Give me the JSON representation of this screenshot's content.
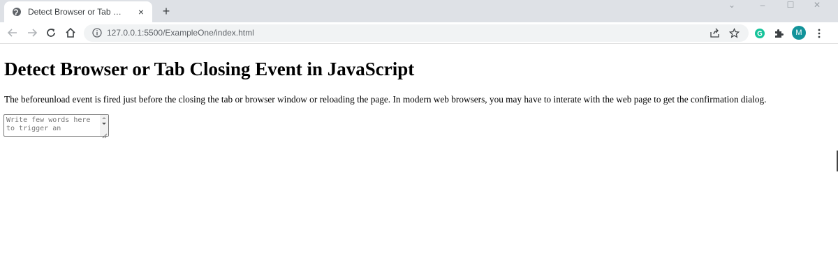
{
  "browser": {
    "tab": {
      "title": "Detect Browser or Tab Closing Event in JavaScript",
      "close_glyph": "×",
      "favicon": "globe-icon"
    },
    "new_tab_glyph": "+",
    "window_controls": [
      "⌄",
      "–",
      "☐",
      "✕"
    ],
    "toolbar": {
      "url": "127.0.0.1:5500/ExampleOne/index.html",
      "profile_initial": "M",
      "accent": "#12939a"
    }
  },
  "page": {
    "heading": "Detect Browser or Tab Closing Event in JavaScript",
    "description": "The beforeunload event is fired just before the closing the tab or browser window or reloading the page. In modern web browsers, you may have to interate with the web page to get the confirmation dialog.",
    "textarea": {
      "placeholder": "Write few words here to trigger an"
    }
  }
}
